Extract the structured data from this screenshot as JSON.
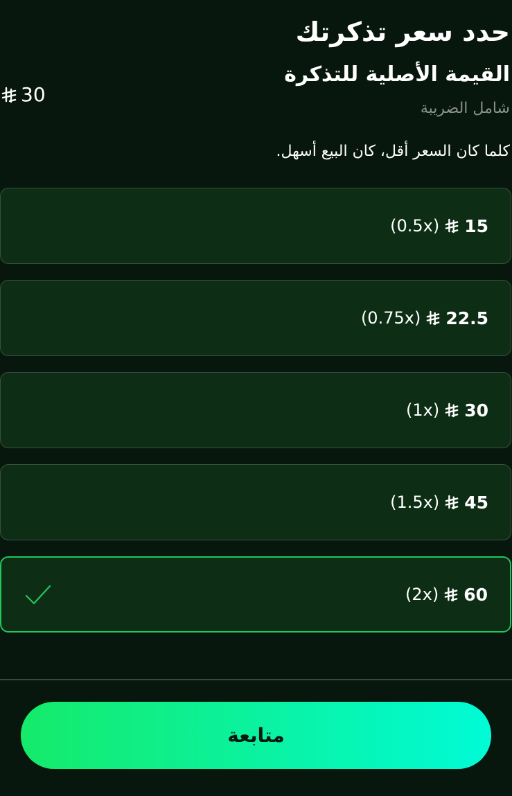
{
  "header": {
    "title": "حدد سعر تذكرتك",
    "original_value_label": "القيمة الأصلية للتذكرة",
    "tax_note": "شامل الضريبة",
    "original_value": "30",
    "currency_icon": "saudi-riyal-icon"
  },
  "hint": "كلما كان السعر أقل، كان البيع أسهل.",
  "options": [
    {
      "price": "15",
      "multiplier": "(0.5x)",
      "selected": false
    },
    {
      "price": "22.5",
      "multiplier": "(0.75x)",
      "selected": false
    },
    {
      "price": "30",
      "multiplier": "(1x)",
      "selected": false
    },
    {
      "price": "45",
      "multiplier": "(1.5x)",
      "selected": false
    },
    {
      "price": "60",
      "multiplier": "(2x)",
      "selected": true
    }
  ],
  "continue_label": "متابعة",
  "colors": {
    "background": "#08170d",
    "option_bg": "#0d2e15",
    "option_border": "#38503e",
    "selected_border": "#22c55e",
    "check": "#22c55e",
    "button_gradient_start": "#15ea6a",
    "button_gradient_end": "#00fbd6",
    "muted_text": "#8a938d"
  }
}
